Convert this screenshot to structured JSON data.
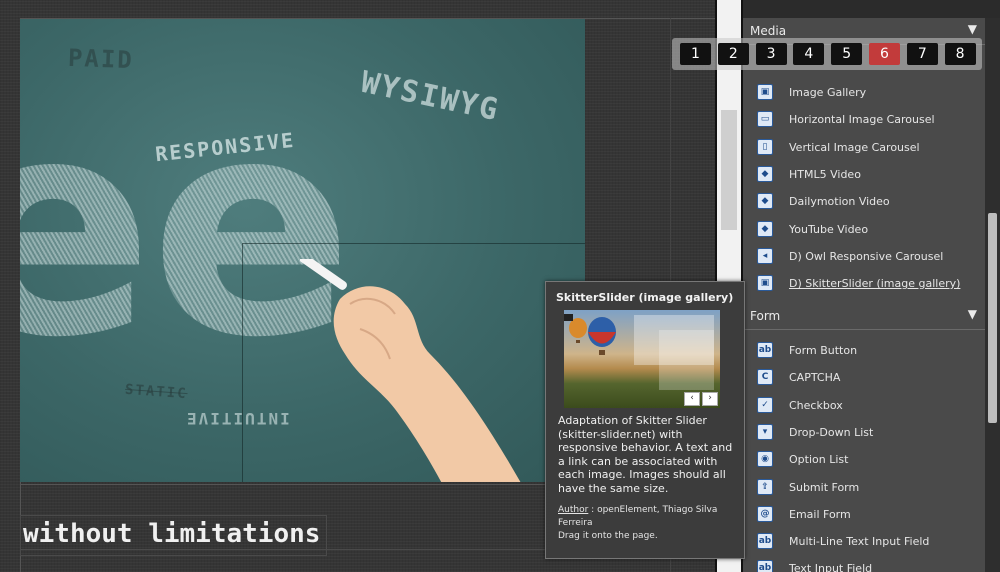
{
  "canvas": {
    "chalk_words": {
      "paid": "PAID",
      "wysiwyg": "WYSIWYG",
      "responsive": "RESPONSIVE",
      "static": "STATIC",
      "intuitive": "INTUITIVE",
      "big_letter": "e"
    },
    "tagline": "without limitations"
  },
  "pager": {
    "pages": [
      "1",
      "2",
      "3",
      "4",
      "5",
      "6",
      "7",
      "8"
    ],
    "active": "6",
    "active_color": "#c23b3b"
  },
  "sidebar": {
    "media_section": {
      "title": "Media",
      "toggle_icon": "triangle-down-icon",
      "items": [
        {
          "label": "Image Gallery",
          "icon": "image-icon"
        },
        {
          "label": "Horizontal Image Carousel",
          "icon": "carousel-horizontal-icon"
        },
        {
          "label": "Vertical Image Carousel",
          "icon": "carousel-vertical-icon"
        },
        {
          "label": "HTML5 Video",
          "icon": "video-icon"
        },
        {
          "label": "Dailymotion Video",
          "icon": "video-icon"
        },
        {
          "label": "YouTube Video",
          "icon": "video-icon"
        },
        {
          "label": "D) Owl Responsive Carousel",
          "icon": "carousel-icon"
        },
        {
          "label": "D) SkitterSlider (image gallery)",
          "icon": "image-icon"
        }
      ]
    },
    "form_section": {
      "title": "Form",
      "toggle_icon": "triangle-down-icon",
      "items": [
        {
          "label": "Form Button",
          "icon": "button-icon"
        },
        {
          "label": "CAPTCHA",
          "icon": "captcha-icon"
        },
        {
          "label": "Checkbox",
          "icon": "checkbox-icon"
        },
        {
          "label": "Drop-Down List",
          "icon": "dropdown-icon"
        },
        {
          "label": "Option  List",
          "icon": "radio-icon"
        },
        {
          "label": "Submit Form",
          "icon": "submit-icon"
        },
        {
          "label": "Email Form",
          "icon": "email-icon"
        },
        {
          "label": "Multi-Line Text Input Field",
          "icon": "textarea-icon"
        },
        {
          "label": "Text Input Field",
          "icon": "text-input-icon"
        }
      ]
    }
  },
  "tooltip": {
    "title": "SkitterSlider (image gallery)",
    "description": "Adaptation of Skitter Slider (skitter-slider.net) with responsive behavior. A text and a link can be associated with each image. Images should all have the same size.",
    "author_label": "Author",
    "author_value": " : openElement, Thiago Silva Ferreira",
    "drag_hint": "Drag it onto the page.",
    "prev_icon": "chevron-left-icon",
    "next_icon": "chevron-right-icon"
  }
}
